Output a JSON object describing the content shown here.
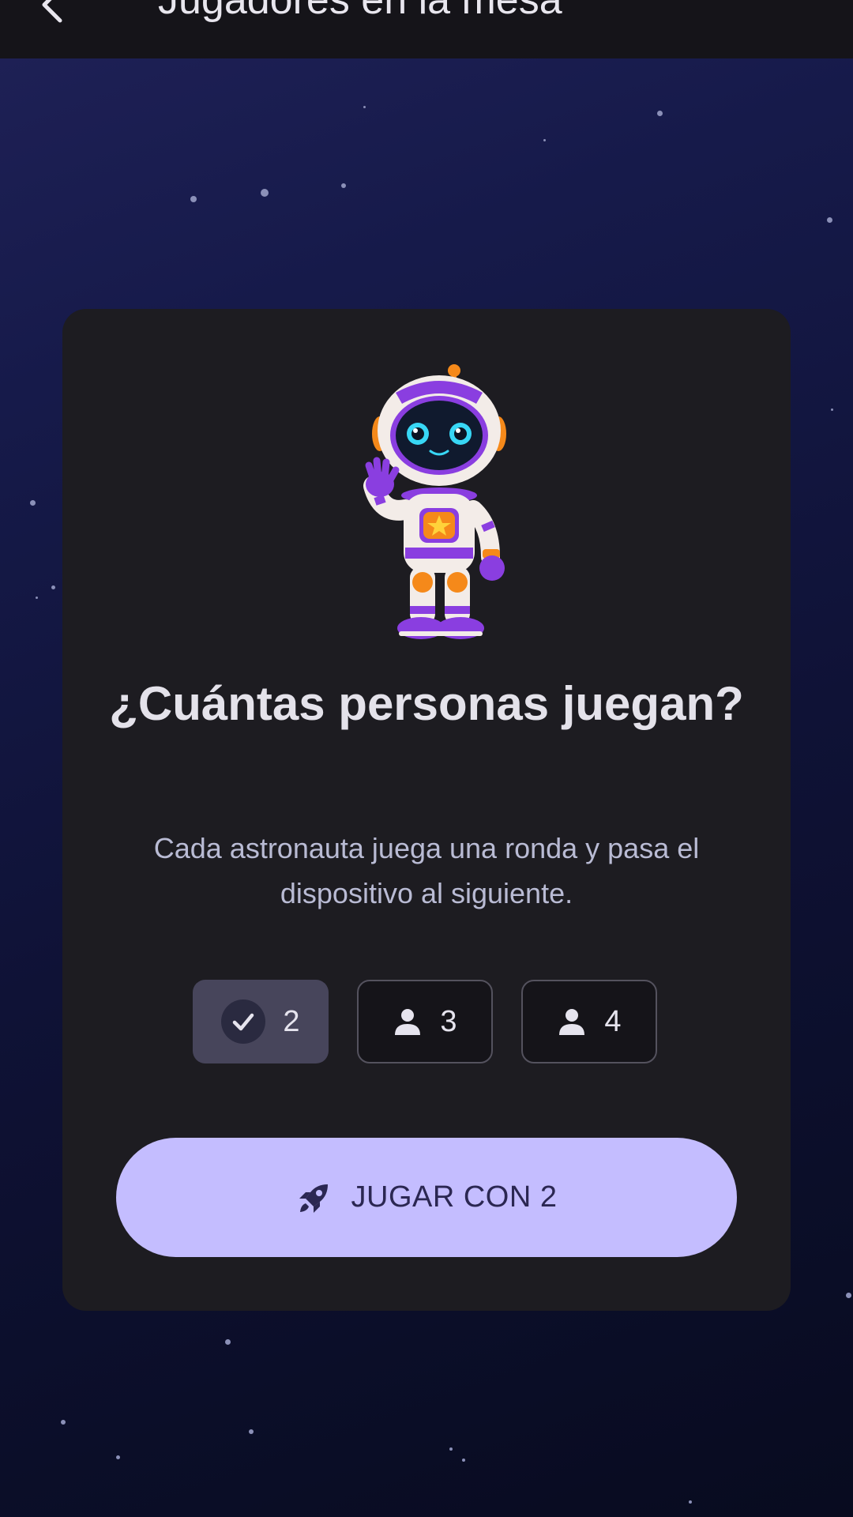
{
  "header": {
    "title": "Jugadores en la mesa",
    "back_icon": "arrow-back-icon"
  },
  "card": {
    "mascot": "astronaut-mascot",
    "title": "¿Cuántas personas juegan?",
    "subtitle": "Cada astronauta juega una ronda y pasa el dispositivo al siguiente."
  },
  "player_options": [
    {
      "label": "2",
      "icon": "check-icon",
      "selected": true
    },
    {
      "label": "3",
      "icon": "person-icon",
      "selected": false
    },
    {
      "label": "4",
      "icon": "person-icon",
      "selected": false
    }
  ],
  "play_button": {
    "label": "JUGAR CON 2",
    "icon": "rocket-icon"
  },
  "colors": {
    "background_top": "#1f2157",
    "background_bottom": "#080b1f",
    "card": "#1d1c21",
    "accent": "#c4bdff",
    "chip_selected": "#47455b",
    "astronaut_purple": "#8a3ee0",
    "astronaut_orange": "#f5891a"
  }
}
